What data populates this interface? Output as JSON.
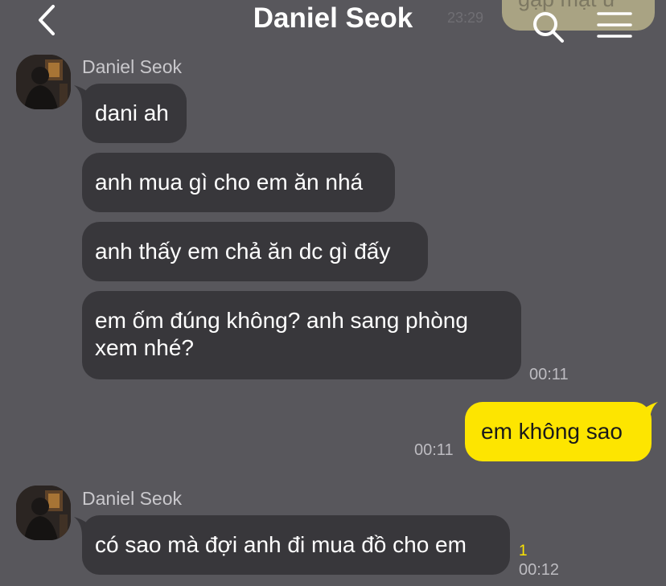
{
  "header": {
    "title": "Daniel Seok",
    "back_icon": "chevron-left-icon",
    "search_icon": "search-icon",
    "menu_icon": "hamburger-menu-icon",
    "overlap_time": "23:29",
    "overlap_bubble_text": "gặp mặt ừ"
  },
  "colors": {
    "background": "#58575c",
    "incoming_bubble": "#38373b",
    "outgoing_bubble": "#fde500",
    "unread_count": "#fde500"
  },
  "messages": {
    "group1": {
      "sender": "Daniel Seok",
      "m1": "dani ah",
      "m2": "anh mua gì cho em ăn nhá",
      "m3": "anh thấy em chả ăn dc gì đấy",
      "m4": "em ốm đúng không? anh sang phòng xem nhé?",
      "time": "00:11"
    },
    "mine": {
      "text": "em không sao",
      "time": "00:11"
    },
    "group2": {
      "sender": "Daniel Seok",
      "m1": "có sao mà đợi anh đi mua đồ cho em",
      "unread": "1",
      "time": "00:12"
    }
  }
}
